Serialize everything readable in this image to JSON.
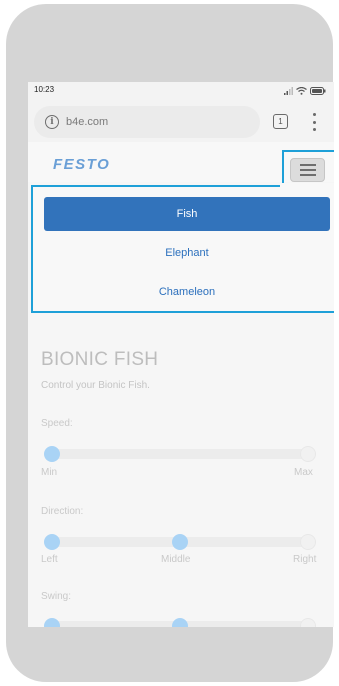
{
  "status": {
    "time": "10:23"
  },
  "browser": {
    "url": "b4e.com",
    "tab_count": "1"
  },
  "site": {
    "logo": "FESTO"
  },
  "menu": {
    "items": [
      {
        "label": "Fish",
        "active": true
      },
      {
        "label": "Elephant",
        "active": false
      },
      {
        "label": "Chameleon",
        "active": false
      }
    ]
  },
  "content": {
    "title": "BIONIC FISH",
    "subtitle": "Control your Bionic Fish.",
    "speed": {
      "label": "Speed:",
      "min": "Min",
      "max": "Max",
      "value": 0.0
    },
    "direction": {
      "label": "Direction:",
      "left": "Left",
      "middle": "Middle",
      "right": "Right",
      "value": 0.5
    },
    "swing": {
      "label": "Swing:",
      "value": 0.5
    }
  },
  "colors": {
    "accent": "#3273bb",
    "highlight_frame": "#1ea0d8",
    "slider_knob": "#a9d3f5"
  }
}
